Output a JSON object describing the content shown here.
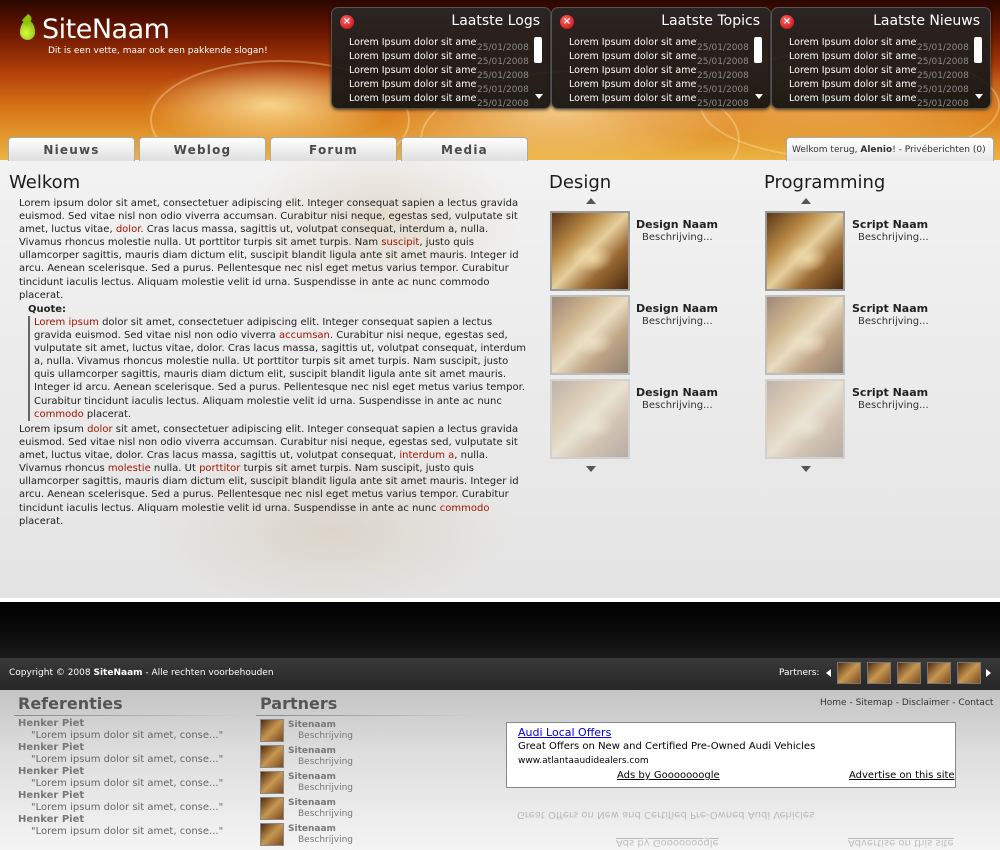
{
  "site": {
    "name": "SiteNaam",
    "slogan": "Dit is een vette, maar ook een pakkende slogan!"
  },
  "panels": [
    {
      "title": "Laatste Logs",
      "items": [
        {
          "text": "Lorem Ipsum dolor sit amet",
          "date": "25/01/2008"
        },
        {
          "text": "Lorem Ipsum dolor sit amet",
          "date": "25/01/2008"
        },
        {
          "text": "Lorem Ipsum dolor sit amet",
          "date": "25/01/2008"
        },
        {
          "text": "Lorem Ipsum dolor sit amet",
          "date": "25/01/2008"
        },
        {
          "text": "Lorem Ipsum dolor sit amet",
          "date": "25/01/2008"
        }
      ]
    },
    {
      "title": "Laatste Topics",
      "items": [
        {
          "text": "Lorem Ipsum dolor sit amet",
          "date": "25/01/2008"
        },
        {
          "text": "Lorem Ipsum dolor sit amet",
          "date": "25/01/2008"
        },
        {
          "text": "Lorem Ipsum dolor sit amet",
          "date": "25/01/2008"
        },
        {
          "text": "Lorem Ipsum dolor sit amet",
          "date": "25/01/2008"
        },
        {
          "text": "Lorem Ipsum dolor sit amet",
          "date": "25/01/2008"
        }
      ]
    },
    {
      "title": "Laatste Nieuws",
      "items": [
        {
          "text": "Lorem Ipsum dolor sit amet",
          "date": "25/01/2008"
        },
        {
          "text": "Lorem Ipsum dolor sit amet",
          "date": "25/01/2008"
        },
        {
          "text": "Lorem Ipsum dolor sit amet",
          "date": "25/01/2008"
        },
        {
          "text": "Lorem Ipsum dolor sit amet",
          "date": "25/01/2008"
        },
        {
          "text": "Lorem Ipsum dolor sit amet",
          "date": "25/01/2008"
        }
      ]
    }
  ],
  "nav": {
    "tabs": [
      "Nieuws",
      "Weblog",
      "Forum",
      "Media"
    ]
  },
  "user": {
    "greeting": "Welkom terug,",
    "name": "Alenio",
    "suffix": "! -",
    "messages": "Privéberichten (0)"
  },
  "welcome": {
    "title": "Welkom",
    "quote_label": "Quote:"
  },
  "design": {
    "title": "Design",
    "items": [
      {
        "name": "Design Naam",
        "desc": "Beschrijving..."
      },
      {
        "name": "Design Naam",
        "desc": "Beschrijving..."
      },
      {
        "name": "Design Naam",
        "desc": "Beschrijving..."
      }
    ]
  },
  "programming": {
    "title": "Programming",
    "items": [
      {
        "name": "Script Naam",
        "desc": "Beschrijving..."
      },
      {
        "name": "Script Naam",
        "desc": "Beschrijving..."
      },
      {
        "name": "Script Naam",
        "desc": "Beschrijving..."
      }
    ]
  },
  "footer": {
    "copyright_prefix": "Copyright © 2008",
    "copyright_site": "SiteNaam",
    "copyright_suffix": "- Alle rechten voorbehouden",
    "partners_label": "Partners:",
    "links": [
      "Home",
      "Sitemap",
      "Disclaimer",
      "Contact"
    ]
  },
  "referenties": {
    "title": "Referenties",
    "items": [
      {
        "name": "Henker Piet",
        "text": "\"Lorem ipsum dolor sit amet, conse...\""
      },
      {
        "name": "Henker Piet",
        "text": "\"Lorem ipsum dolor sit amet, conse...\""
      },
      {
        "name": "Henker Piet",
        "text": "\"Lorem ipsum dolor sit amet, conse...\""
      },
      {
        "name": "Henker Piet",
        "text": "\"Lorem ipsum dolor sit amet, conse...\""
      },
      {
        "name": "Henker Piet",
        "text": "\"Lorem ipsum dolor sit amet, conse...\""
      }
    ]
  },
  "partners": {
    "title": "Partners",
    "items": [
      {
        "name": "Sitenaam",
        "desc": "Beschrijving"
      },
      {
        "name": "Sitenaam",
        "desc": "Beschrijving"
      },
      {
        "name": "Sitenaam",
        "desc": "Beschrijving"
      },
      {
        "name": "Sitenaam",
        "desc": "Beschrijving"
      },
      {
        "name": "Sitenaam",
        "desc": "Beschrijving"
      }
    ]
  },
  "ad": {
    "title": "Audi Local Offers",
    "desc": "Great Offers on New and Certified Pre-Owned Audi Vehicles",
    "url": "www.atlantaaudidealers.com",
    "by": "Ads by Gooooooogle",
    "advertise": "Advertise on this site"
  },
  "colors": {
    "highlight": "#a01600",
    "ad_link": "#0000cc"
  }
}
